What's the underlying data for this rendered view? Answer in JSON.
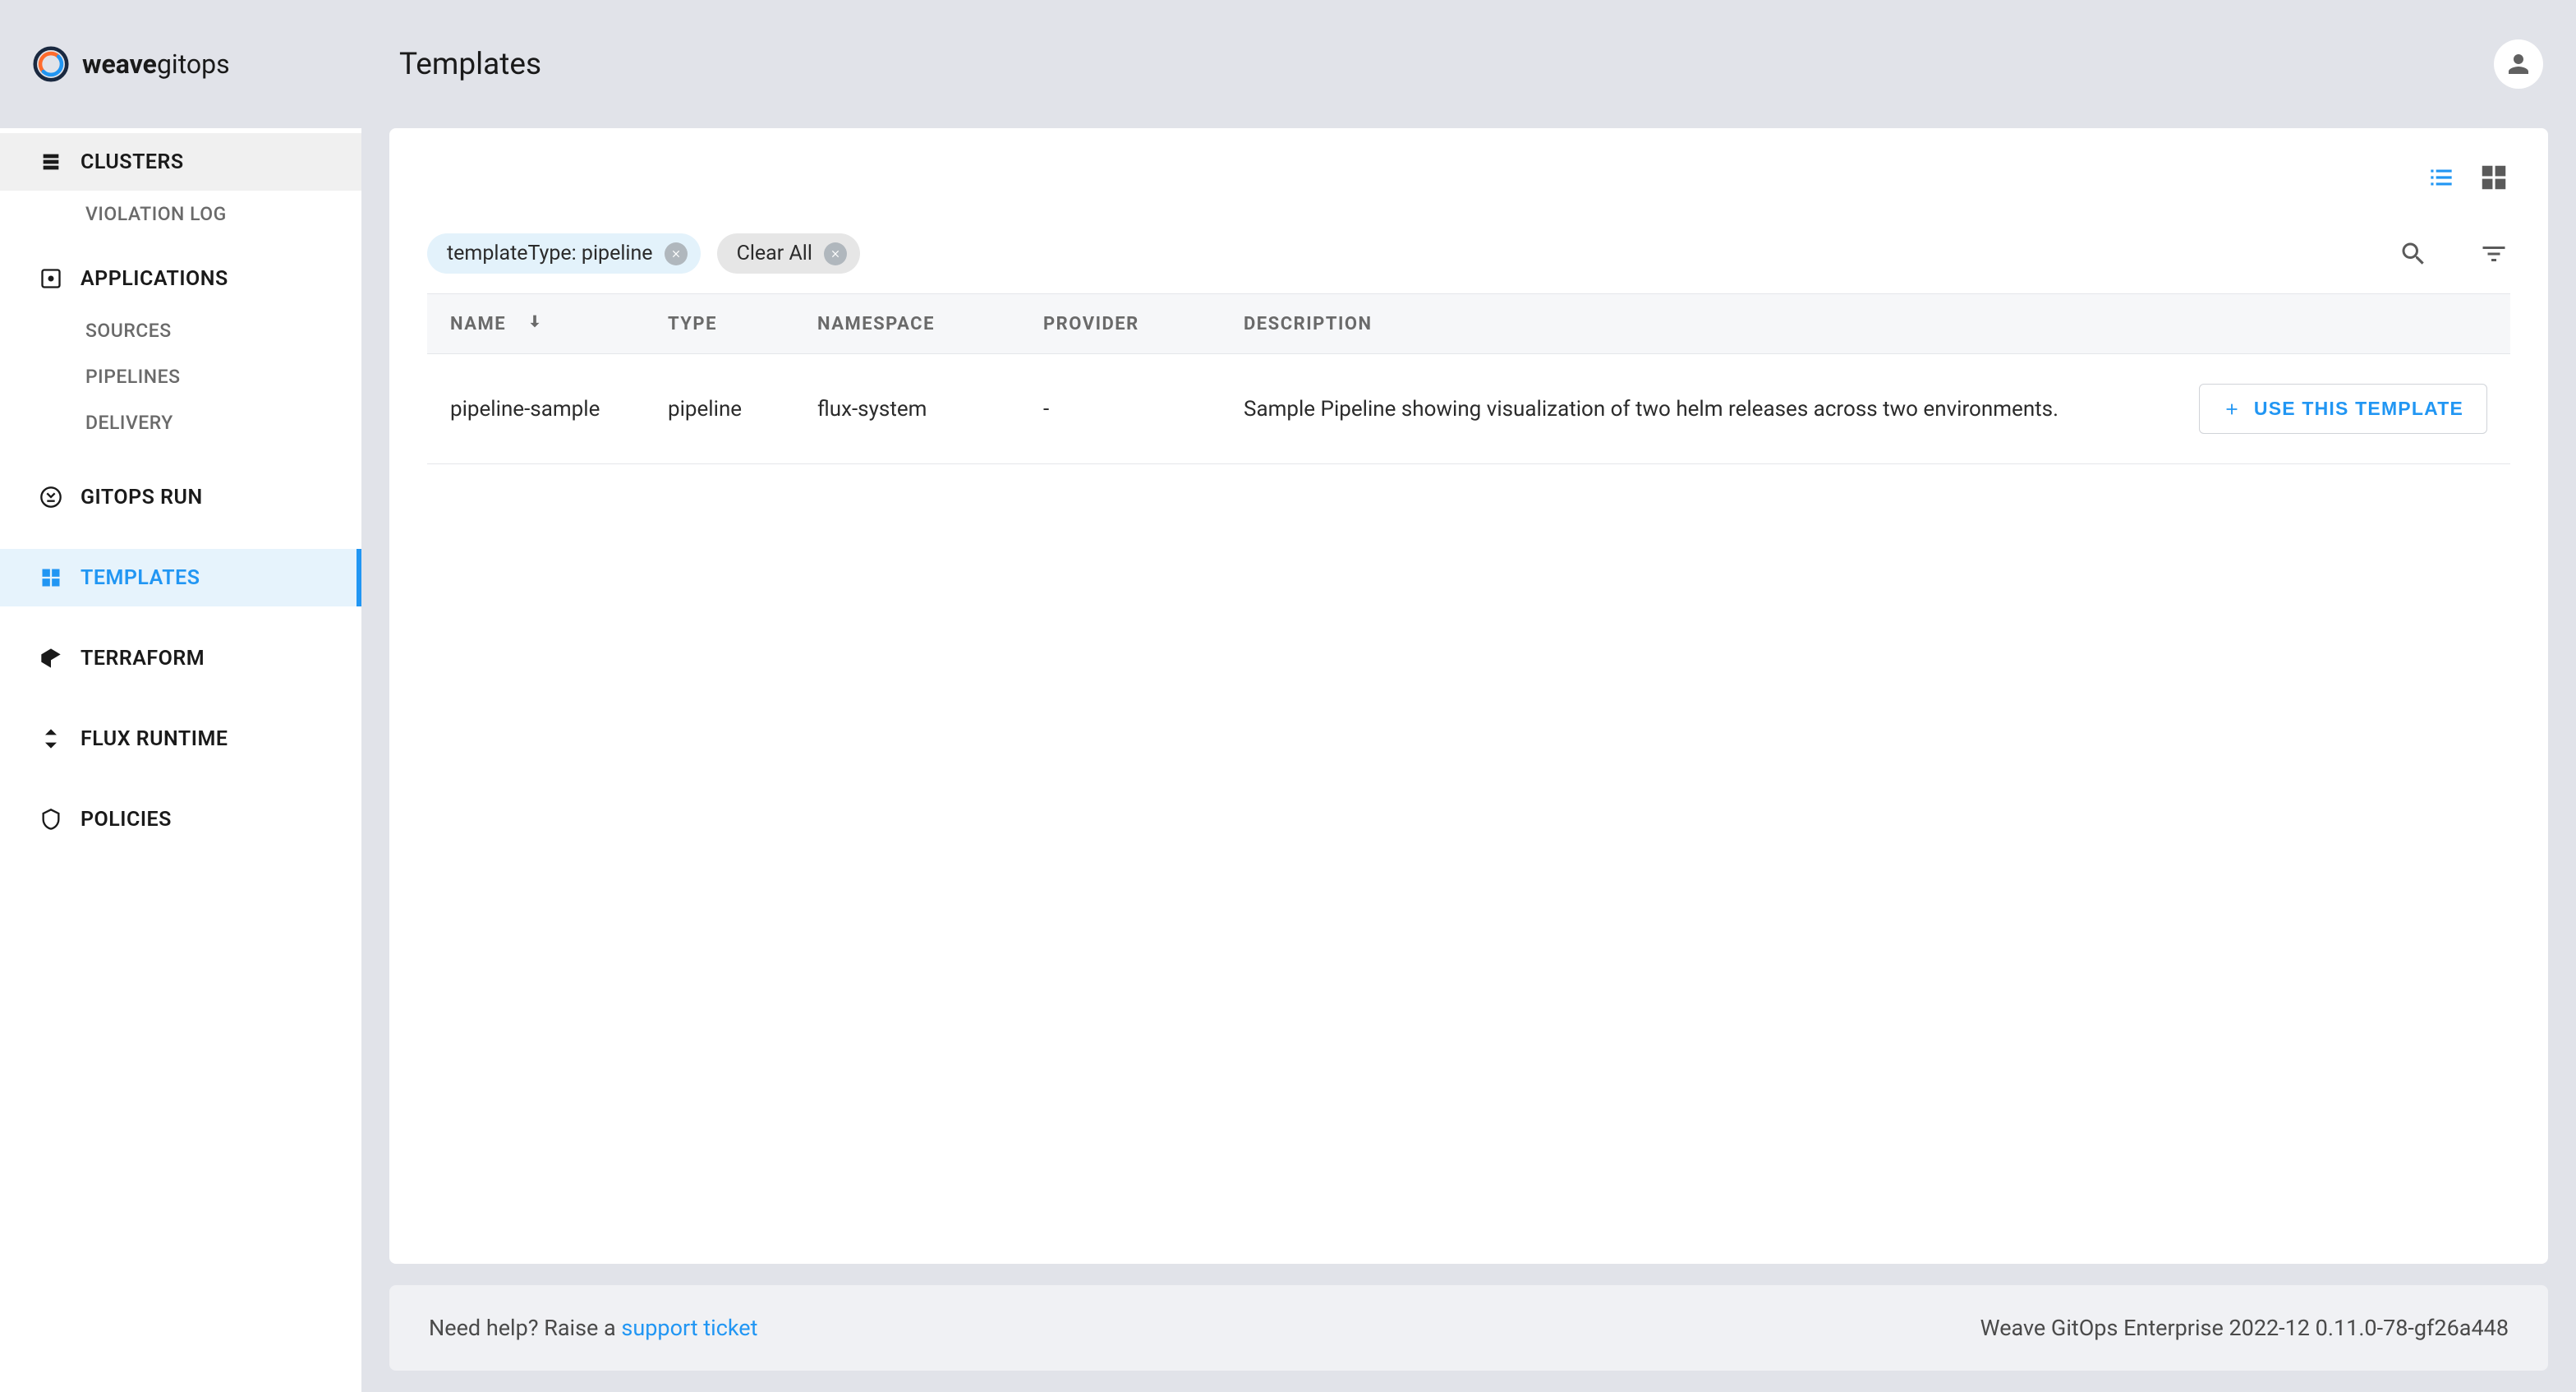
{
  "brand": {
    "name_bold": "weave",
    "name_light": "gitops"
  },
  "page": {
    "title": "Templates"
  },
  "sidebar": {
    "items": [
      {
        "label": "CLUSTERS"
      },
      {
        "label": "VIOLATION LOG"
      },
      {
        "label": "APPLICATIONS"
      },
      {
        "label": "SOURCES"
      },
      {
        "label": "PIPELINES"
      },
      {
        "label": "DELIVERY"
      },
      {
        "label": "GITOPS RUN"
      },
      {
        "label": "TEMPLATES"
      },
      {
        "label": "TERRAFORM"
      },
      {
        "label": "FLUX RUNTIME"
      },
      {
        "label": "POLICIES"
      }
    ]
  },
  "filters": {
    "chips": [
      {
        "label": "templateType: pipeline"
      }
    ],
    "clear_all": "Clear All"
  },
  "table": {
    "headers": {
      "name": "Name",
      "type": "Type",
      "namespace": "Namespace",
      "provider": "Provider",
      "description": "Description"
    },
    "rows": [
      {
        "name": "pipeline-sample",
        "type": "pipeline",
        "namespace": "flux-system",
        "provider": "-",
        "description": "Sample Pipeline showing visualization of two helm releases across two environments.",
        "action_label": "USE THIS TEMPLATE"
      }
    ]
  },
  "footer": {
    "help_prefix": "Need help? Raise a ",
    "help_link": "support ticket",
    "version": "Weave GitOps Enterprise 2022-12 0.11.0-78-gf26a448"
  }
}
